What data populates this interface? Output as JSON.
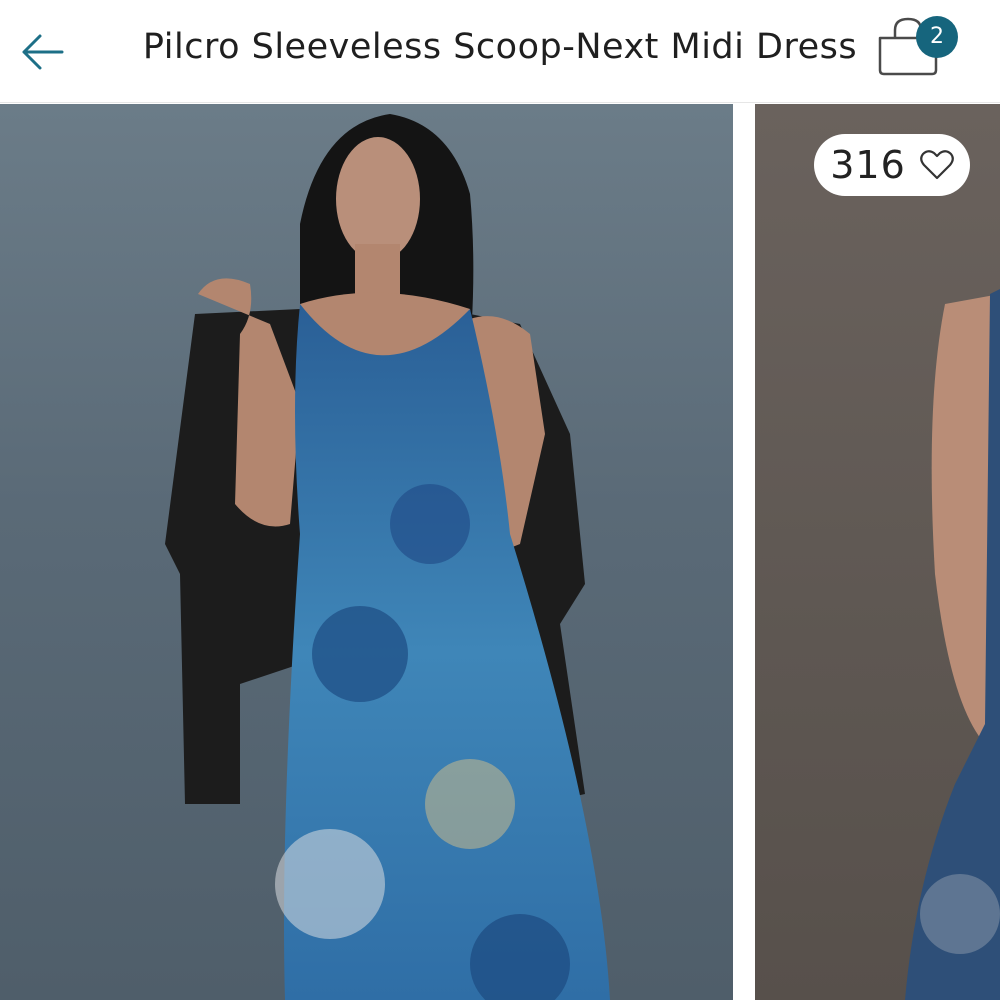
{
  "header": {
    "title": "Pilcro Sleeveless Scoop-Next Midi Dress",
    "back_icon": "arrow-left-icon",
    "bag_icon": "shopping-bag-icon",
    "bag_count": "2"
  },
  "gallery": {
    "like_count": "316",
    "like_icon": "heart-outline-icon"
  },
  "colors": {
    "accent": "#16657d",
    "header_bg": "#ffffff"
  }
}
